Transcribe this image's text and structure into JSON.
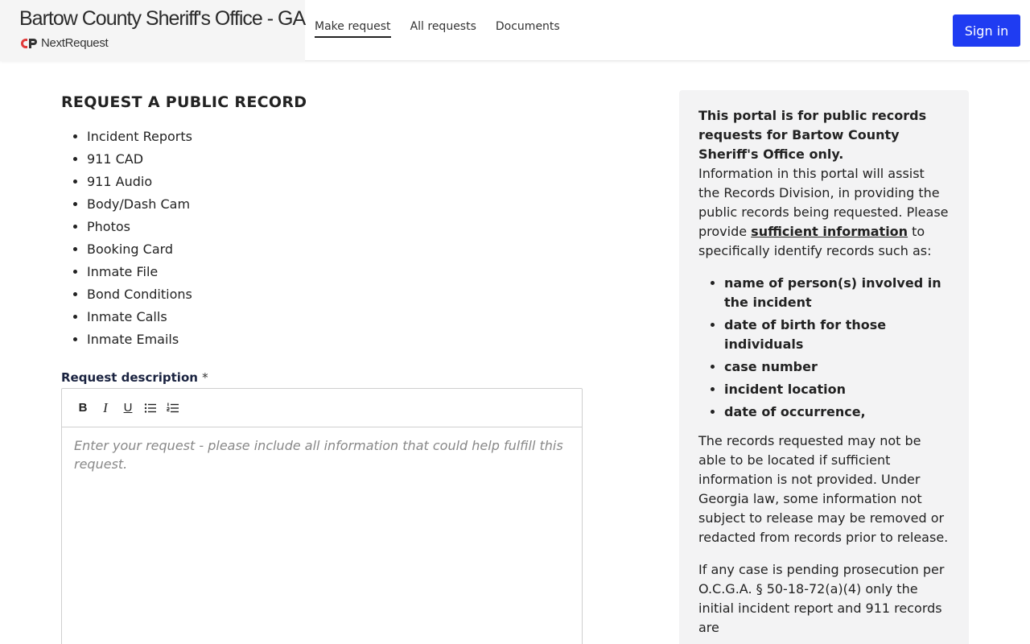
{
  "header": {
    "agency_name": "Bartow County Sheriff's Office - GA",
    "logo_text": "NextRequest",
    "nav": [
      {
        "label": "Make request",
        "active": true
      },
      {
        "label": "All requests",
        "active": false
      },
      {
        "label": "Documents",
        "active": false
      }
    ],
    "sign_in_label": "Sign in",
    "accent_color": "#1f3cf2"
  },
  "main": {
    "title": "REQUEST A PUBLIC RECORD",
    "record_types": [
      "Incident Reports",
      "911 CAD",
      "911 Audio",
      "Body/Dash Cam",
      "Photos",
      "Booking Card",
      "Inmate File",
      "Bond Conditions",
      "Inmate Calls",
      "Inmate Emails"
    ],
    "description_label": "Request description",
    "required_mark": "*",
    "toolbar": [
      {
        "icon": "bold-icon",
        "glyph": "B"
      },
      {
        "icon": "italic-icon",
        "glyph": "I"
      },
      {
        "icon": "underline-icon",
        "glyph": "U"
      },
      {
        "icon": "bullet-list-icon",
        "glyph": ""
      },
      {
        "icon": "numbered-list-icon",
        "glyph": ""
      }
    ],
    "description_placeholder": "Enter your request - please include all information that could help fulfill this request."
  },
  "sidebar": {
    "intro_bold": "This portal is for public records requests for Bartow County Sheriff's Office only.",
    "info_before_link": "Information in this portal will assist the Records Division, in providing the public records being requested. Please provide ",
    "info_link": "sufficient information",
    "info_after_link": " to specifically identify records such as:",
    "criteria": [
      "name of person(s) involved in the incident",
      "date of birth for those individuals",
      "case number",
      "incident location",
      "date of occurrence,"
    ],
    "para_records": "The records requested may not be able to be located if sufficient information is not provided. Under Georgia law, some information not subject to release may be removed or redacted from records prior to release.",
    "para_pending": "If any case is pending prosecution per O.C.G.A. § 50-18-72(a)(4) only the initial incident report and 911 records are"
  }
}
